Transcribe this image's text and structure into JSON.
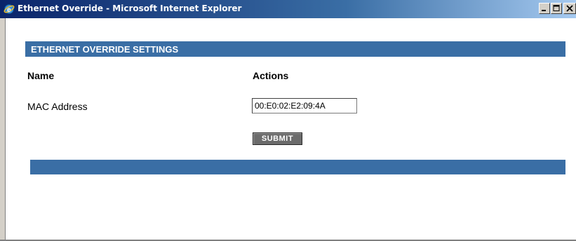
{
  "window": {
    "title": "Ethernet Override - Microsoft Internet Explorer",
    "icon": "ie-icon",
    "buttons": [
      "minimize",
      "maximize",
      "close"
    ]
  },
  "section": {
    "title": "ETHERNET OVERRIDE SETTINGS"
  },
  "columns": {
    "name": "Name",
    "actions": "Actions"
  },
  "rows": [
    {
      "label": "MAC Address",
      "value": "00:E0:02:E2:09:4A"
    }
  ],
  "submit_label": "SUBMIT",
  "colors": {
    "header_bar": "#3a6ea5",
    "title_bar": "#0a246a",
    "submit_bg": "#6b6b6b"
  }
}
